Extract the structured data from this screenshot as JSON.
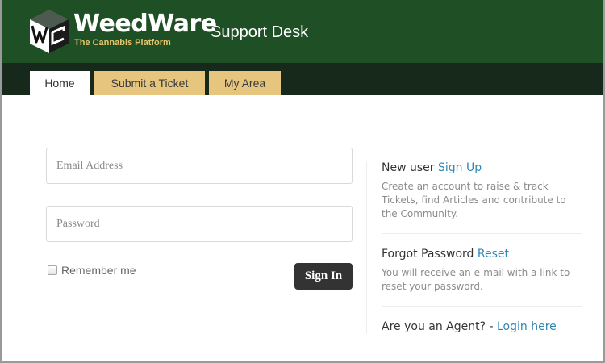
{
  "brand": {
    "name": "WeedWare",
    "tagline": "The Cannabis Platform",
    "colors": {
      "header_bg": "#1f4f24",
      "nav_bg": "#17291a",
      "accent_gold": "#e6c57f",
      "link": "#2f86b5"
    }
  },
  "header": {
    "title": "Support Desk"
  },
  "nav": {
    "tabs": [
      {
        "label": "Home",
        "active": true
      },
      {
        "label": "Submit a Ticket",
        "active": false
      },
      {
        "label": "My Area",
        "active": false
      }
    ]
  },
  "login": {
    "email_placeholder": "Email Address",
    "password_placeholder": "Password",
    "remember_label": "Remember me",
    "remember_checked": false,
    "signin_label": "Sign In"
  },
  "side": {
    "new_user": {
      "text": "New user",
      "link": "Sign Up",
      "description": "Create an account to raise & track Tickets, find Articles and contribute to the Community."
    },
    "forgot": {
      "text": "Forgot Password",
      "link": "Reset",
      "description": "You will receive an e-mail with a link to reset your password."
    },
    "agent": {
      "text": "Are you an Agent? -",
      "link": "Login here"
    }
  }
}
